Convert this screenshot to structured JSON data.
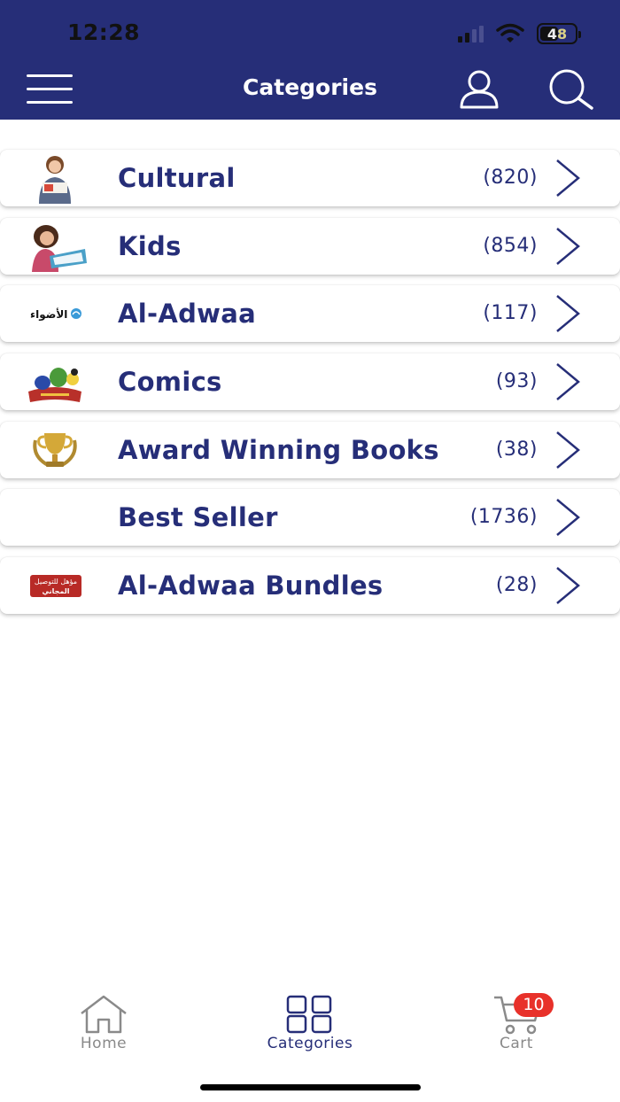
{
  "status_bar": {
    "time": "12:28",
    "battery": "48"
  },
  "header": {
    "title": "Categories"
  },
  "categories": [
    {
      "label": "Cultural",
      "count": "(820)",
      "thumb": "girl-reading-image"
    },
    {
      "label": "Kids",
      "count": "(854)",
      "thumb": "child-reading-image"
    },
    {
      "label": "Al-Adwaa",
      "count": "(117)",
      "thumb": "al-adwaa-logo",
      "thumb_text": "الأضواء"
    },
    {
      "label": "Comics",
      "count": "(93)",
      "thumb": "comics-characters-image"
    },
    {
      "label": "Award Winning Books",
      "count": "(38)",
      "thumb": "trophy-icon"
    },
    {
      "label": "Best Seller",
      "count": "(1736)",
      "thumb": ""
    },
    {
      "label": "Al-Adwaa Bundles",
      "count": "(28)",
      "thumb": "free-delivery-badge",
      "thumb_text_1": "مؤهل للتوصيل",
      "thumb_text_2": "المجاني"
    }
  ],
  "tabbar": {
    "home": "Home",
    "categories": "Categories",
    "cart": "Cart",
    "cart_badge": "10"
  },
  "colors": {
    "brand": "#262e78",
    "badge": "#e8312a",
    "inactive_tab": "#8a8a8a"
  }
}
